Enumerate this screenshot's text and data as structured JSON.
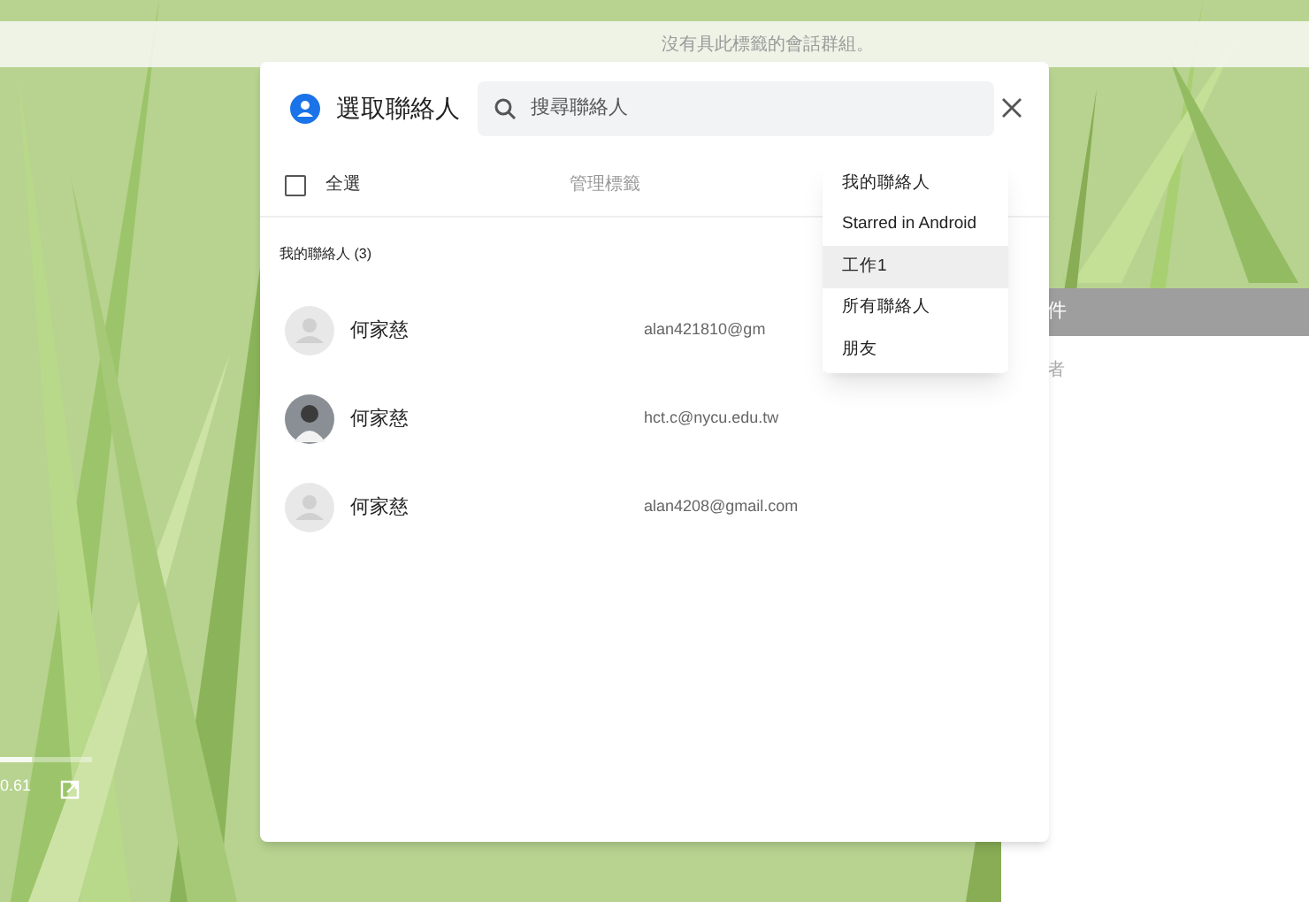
{
  "top_bar": {
    "message": "沒有具此標籤的會話群組。"
  },
  "background_panel": {
    "header": "件",
    "line": "者"
  },
  "player": {
    "time": "0.61",
    "level": 0.35
  },
  "dialog": {
    "title": "選取聯絡人",
    "search": {
      "placeholder": "搜尋聯絡人"
    },
    "select_all": {
      "label": "全選",
      "checked": false
    },
    "manage_labels": "管理標籤",
    "group_heading": "我的聯絡人 (3)",
    "contacts": [
      {
        "name": "何家慈",
        "email": "alan421810@gm",
        "kind": "placeholder"
      },
      {
        "name": "何家慈",
        "email": "hct.c@nycu.edu.tw"
      },
      {
        "name": "何家慈",
        "email": "alan4208@gmail.com",
        "kind": "placeholder"
      }
    ]
  },
  "label_menu": [
    {
      "label": "我的聯絡人",
      "selected": false
    },
    {
      "label": "Starred in Android",
      "selected": false
    },
    {
      "label": "工作1",
      "selected": true
    },
    {
      "label": "所有聯絡人",
      "selected": false
    },
    {
      "label": "朋友",
      "selected": false
    }
  ]
}
